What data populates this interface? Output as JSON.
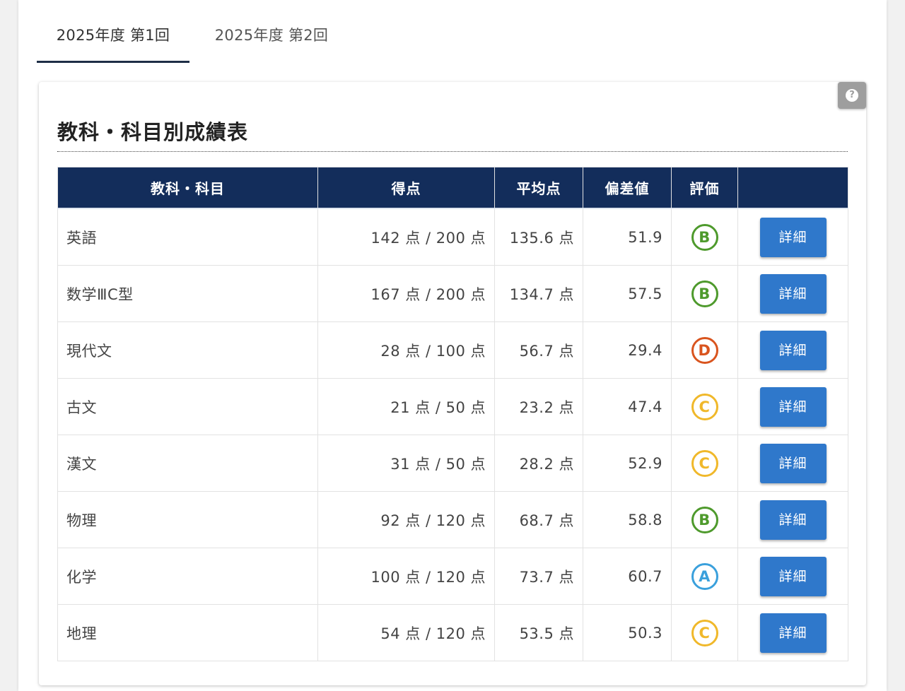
{
  "tabs": [
    {
      "label": "2025年度 第1回",
      "active": true
    },
    {
      "label": "2025年度 第2回",
      "active": false
    }
  ],
  "card": {
    "title": "教科・科目別成績表",
    "help_icon": "question-circle-icon",
    "help_glyph": "?"
  },
  "table": {
    "headers": [
      "教科・科目",
      "得点",
      "平均点",
      "偏差値",
      "評価",
      ""
    ],
    "rows": [
      {
        "subject": "英語",
        "score": "142 点 / 200 点",
        "average": "135.6 点",
        "deviation": "51.9",
        "grade": "B",
        "button": "詳細"
      },
      {
        "subject": "数学ⅢC型",
        "score": "167 点 / 200 点",
        "average": "134.7 点",
        "deviation": "57.5",
        "grade": "B",
        "button": "詳細"
      },
      {
        "subject": "現代文",
        "score": "28 点 / 100 点",
        "average": "56.7 点",
        "deviation": "29.4",
        "grade": "D",
        "button": "詳細"
      },
      {
        "subject": "古文",
        "score": "21 点 / 50 点",
        "average": "23.2 点",
        "deviation": "47.4",
        "grade": "C",
        "button": "詳細"
      },
      {
        "subject": "漢文",
        "score": "31 点 / 50 点",
        "average": "28.2 点",
        "deviation": "52.9",
        "grade": "C",
        "button": "詳細"
      },
      {
        "subject": "物理",
        "score": "92 点 / 120 点",
        "average": "68.7 点",
        "deviation": "58.8",
        "grade": "B",
        "button": "詳細"
      },
      {
        "subject": "化学",
        "score": "100 点 / 120 点",
        "average": "73.7 点",
        "deviation": "60.7",
        "grade": "A",
        "button": "詳細"
      },
      {
        "subject": "地理",
        "score": "54 点 / 120 点",
        "average": "53.5 点",
        "deviation": "50.3",
        "grade": "C",
        "button": "詳細"
      }
    ]
  },
  "grade_colors": {
    "A": "#3aa0dc",
    "B": "#4e9a2c",
    "C": "#f0b82a",
    "D": "#d9541e"
  },
  "colors": {
    "header_bg": "#132d5b",
    "button_bg": "#2f78cb",
    "tab_underline": "#1e2e46"
  }
}
